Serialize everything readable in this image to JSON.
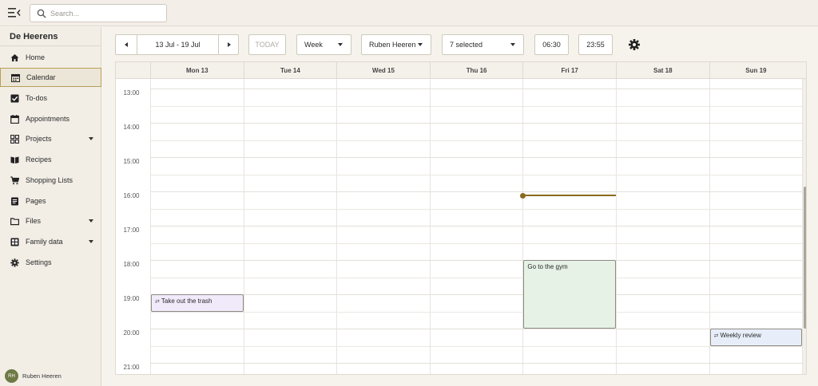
{
  "search": {
    "placeholder": "Search..."
  },
  "sidebar": {
    "brand": "De Heerens",
    "items": [
      {
        "label": "Home",
        "icon": "home-icon",
        "active": false,
        "expandable": false
      },
      {
        "label": "Calendar",
        "icon": "calendar-icon",
        "active": true,
        "expandable": false
      },
      {
        "label": "To-dos",
        "icon": "checkbox-icon",
        "active": false,
        "expandable": false
      },
      {
        "label": "Appointments",
        "icon": "calendar-blank-icon",
        "active": false,
        "expandable": false
      },
      {
        "label": "Projects",
        "icon": "grid-icon",
        "active": false,
        "expandable": true
      },
      {
        "label": "Recipes",
        "icon": "book-icon",
        "active": false,
        "expandable": false
      },
      {
        "label": "Shopping Lists",
        "icon": "cart-icon",
        "active": false,
        "expandable": false
      },
      {
        "label": "Pages",
        "icon": "page-icon",
        "active": false,
        "expandable": false
      },
      {
        "label": "Files",
        "icon": "folder-icon",
        "active": false,
        "expandable": true
      },
      {
        "label": "Family data",
        "icon": "table-icon",
        "active": false,
        "expandable": true
      },
      {
        "label": "Settings",
        "icon": "gear-icon",
        "active": false,
        "expandable": false
      }
    ],
    "user": {
      "initials": "RH",
      "name": "Ruben Heeren"
    }
  },
  "toolbar": {
    "date_range": "13 Jul - 19 Jul",
    "today_label": "TODAY",
    "view": "Week",
    "person": "Ruben Heeren",
    "calendars": "7 selected",
    "start_time": "06:30",
    "end_time": "23:55"
  },
  "calendar": {
    "days": [
      "Mon 13",
      "Tue 14",
      "Wed 15",
      "Thu 16",
      "Fri 17",
      "Sat 18",
      "Sun 19"
    ],
    "times": [
      "13:00",
      "14:00",
      "15:00",
      "16:00",
      "17:00",
      "18:00",
      "19:00",
      "20:00",
      "21:00"
    ],
    "now": {
      "day": "Fri 17",
      "time": "16:06"
    },
    "events": [
      {
        "title": "Take out the trash",
        "day": "Mon 13",
        "start": "19:00",
        "end": "19:30",
        "recurring": true,
        "color": "#f1eafb"
      },
      {
        "title": "Go to the gym",
        "day": "Fri 17",
        "start": "18:00",
        "end": "20:00",
        "recurring": false,
        "color": "#e6f2e6"
      },
      {
        "title": "Weekly review",
        "day": "Sun 19",
        "start": "20:00",
        "end": "20:30",
        "recurring": true,
        "color": "#e8eef9"
      }
    ],
    "recurring_symbol": "⇄"
  },
  "colors": {
    "accent": "#8a6a1e",
    "sidebar_bg": "#f2eee6",
    "page_bg": "#f6f3ec"
  }
}
